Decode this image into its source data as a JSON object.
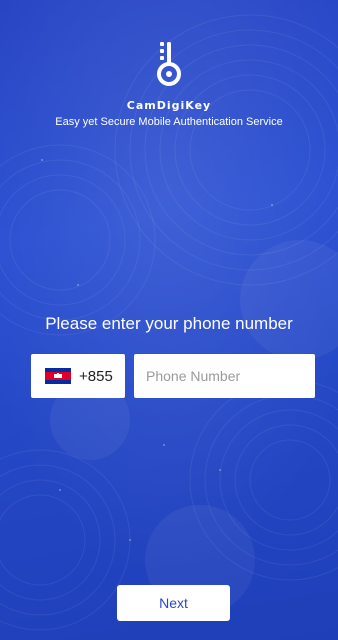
{
  "header": {
    "logo_icon": "key-lock-icon",
    "app_name": "CamDigiKey",
    "tagline": "Easy yet Secure Mobile Authentication Service"
  },
  "form": {
    "prompt": "Please enter your phone number",
    "country": {
      "flag_icon": "cambodia-flag-icon",
      "code": "+855"
    },
    "phone": {
      "value": "",
      "placeholder": "Phone Number"
    },
    "next_label": "Next"
  },
  "colors": {
    "background": "#2a4fd2",
    "accent_text": "#2a47c9",
    "field_bg": "#ffffff"
  }
}
